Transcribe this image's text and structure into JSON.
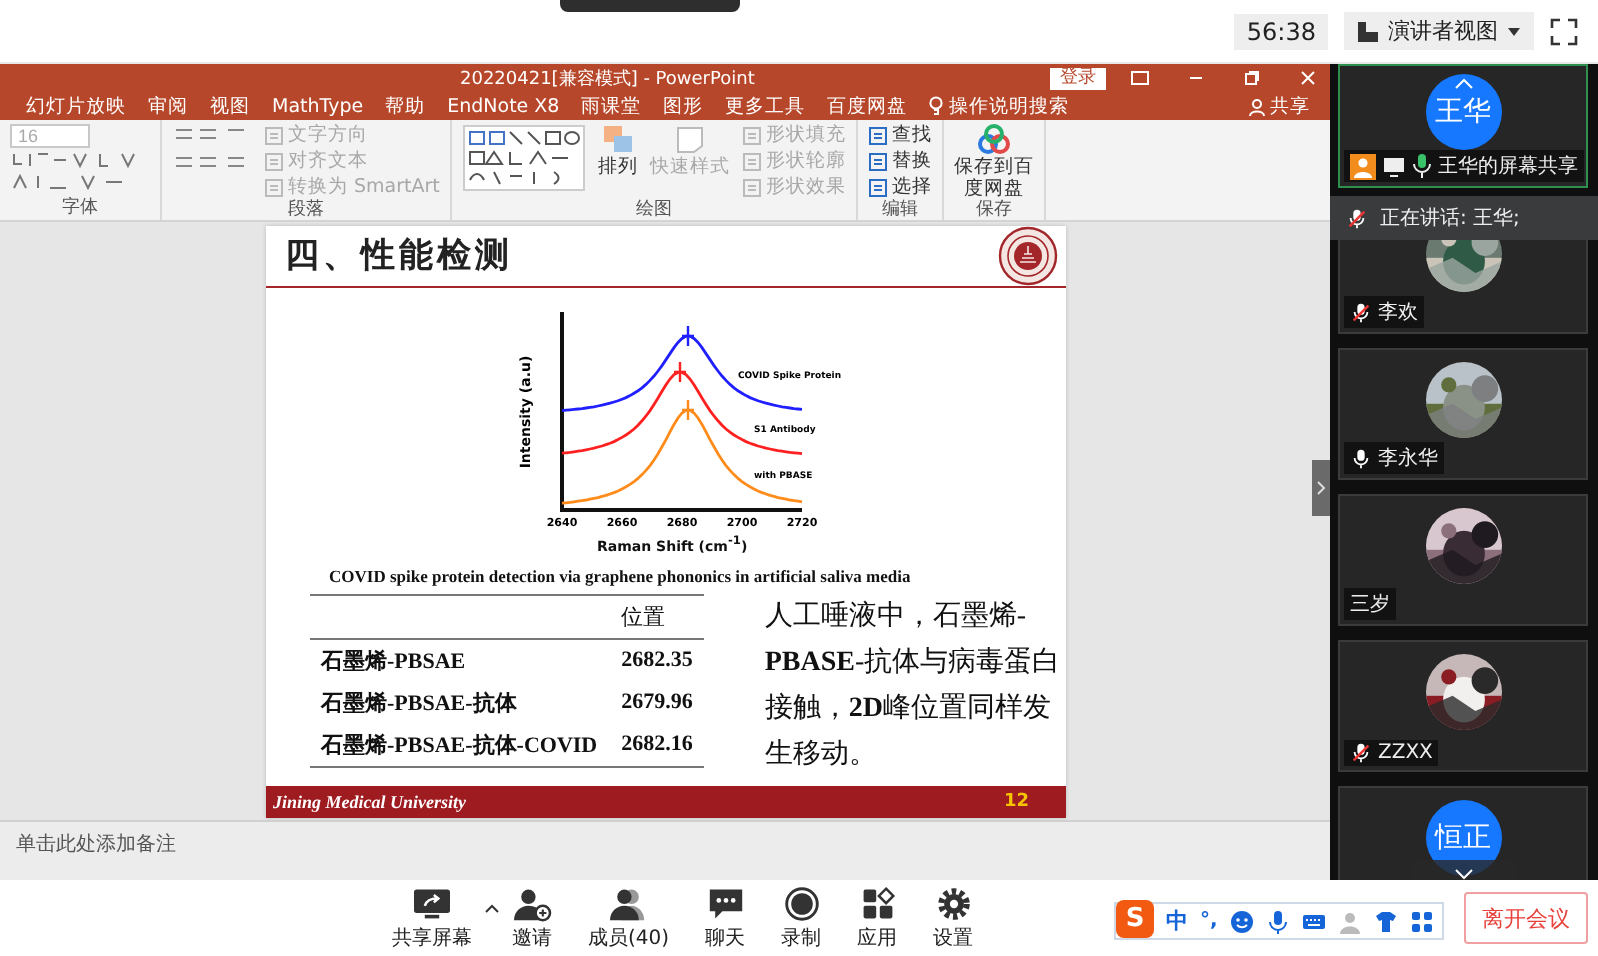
{
  "top_bar": {
    "timer": "56:38",
    "view_button": "演讲者视图"
  },
  "powerpoint": {
    "title": "20220421[兼容模式] - PowerPoint",
    "login_button": "登录",
    "tabs": [
      {
        "label": "幻灯片放映",
        "selected": false
      },
      {
        "label": "审阅",
        "selected": false
      },
      {
        "label": "视图",
        "selected": false
      },
      {
        "label": "MathType",
        "selected": false
      },
      {
        "label": "帮助",
        "selected": false
      },
      {
        "label": "EndNote X8",
        "selected": false
      },
      {
        "label": "雨课堂",
        "selected": false
      },
      {
        "label": "图形",
        "selected": false
      },
      {
        "label": "更多工具",
        "selected": false
      },
      {
        "label": "百度网盘",
        "selected": false
      }
    ],
    "search": "操作说明搜索",
    "share": "共享",
    "font_size": "16",
    "ribbon": [
      {
        "label": "字体",
        "kind": "font"
      },
      {
        "label": "段落",
        "kind": "paragraph",
        "items": [
          {
            "label": "文字方向",
            "disabled": true
          },
          {
            "label": "对齐文本",
            "disabled": true
          },
          {
            "label": "转换为 SmartArt",
            "disabled": true
          }
        ]
      },
      {
        "label": "绘图",
        "kind": "drawing",
        "items": [
          {
            "label": "排列",
            "disabled": false
          },
          {
            "label": "快速样式",
            "disabled": true
          },
          {
            "label": "形状填充",
            "disabled": true
          },
          {
            "label": "形状轮廓",
            "disabled": true
          },
          {
            "label": "形状效果",
            "disabled": true
          }
        ]
      },
      {
        "label": "编辑",
        "kind": "list",
        "items": [
          {
            "label": "查找",
            "disabled": false
          },
          {
            "label": "替换",
            "disabled": false
          },
          {
            "label": "选择",
            "disabled": false
          }
        ]
      },
      {
        "label": "保存",
        "kind": "save",
        "items": [
          {
            "label": "保存到百度网盘",
            "disabled": false
          }
        ]
      }
    ],
    "notes": {
      "placeholder": "单击此处添加备注"
    }
  },
  "slide": {
    "title": "四、性能检测",
    "chart": {
      "ylabel": "Intensity (a.u)",
      "xlabel": "Raman Shift (cm$^{-1}$)",
      "xticks": [
        "2640",
        "2660",
        "2680",
        "2700",
        "2720"
      ],
      "series": [
        {
          "name": "COVID Spike Protein",
          "color": "#1f1fff"
        },
        {
          "name": "S1 Antibody",
          "color": "#ff2020"
        },
        {
          "name": "with PBASE",
          "color": "#ff8c1a"
        }
      ]
    },
    "caption": "COVID spike protein detection via graphene phononics in artificial saliva media",
    "table": {
      "header": "位置",
      "rows": [
        {
          "name": "石墨烯-PBSAE",
          "value": "2682.35"
        },
        {
          "name": "石墨烯-PBSAE-抗体",
          "value": "2679.96"
        },
        {
          "name": "石墨烯-PBSAE-抗体-COVID",
          "value": "2682.16"
        }
      ]
    },
    "paragraph": "人工唾液中，石墨烯-**PBASE**-抗体与病毒蛋白接触，**2D**峰位置同样发生移动。",
    "footer": "Jining Medical University",
    "page": "12"
  },
  "gallery": {
    "presenter": {
      "initials": "王华",
      "label": "王华的屏幕共享"
    },
    "speaking": "正在讲话: 王华;",
    "participants": [
      {
        "name": "李欢",
        "kind": "picture",
        "muted": true
      },
      {
        "name": "李永华",
        "kind": "picture",
        "muted": false
      },
      {
        "name": "三岁",
        "kind": "picture"
      },
      {
        "name": "ZZXX",
        "kind": "picture",
        "muted": true
      },
      {
        "initials": "恒正",
        "kind": "initials"
      }
    ]
  },
  "toolbar": [
    {
      "label": "共享屏幕",
      "kind": "share"
    },
    {
      "label": "邀请",
      "kind": "invite"
    },
    {
      "label": "成员(40)",
      "kind": "members"
    },
    {
      "label": "聊天",
      "kind": "chat"
    },
    {
      "label": "录制",
      "kind": "record"
    },
    {
      "label": "应用",
      "kind": "apps"
    },
    {
      "label": "设置",
      "kind": "settings"
    }
  ],
  "ime": {
    "logo": "S",
    "mode": "中",
    "punctuation": "°,"
  },
  "leave_button": "离开会议"
}
